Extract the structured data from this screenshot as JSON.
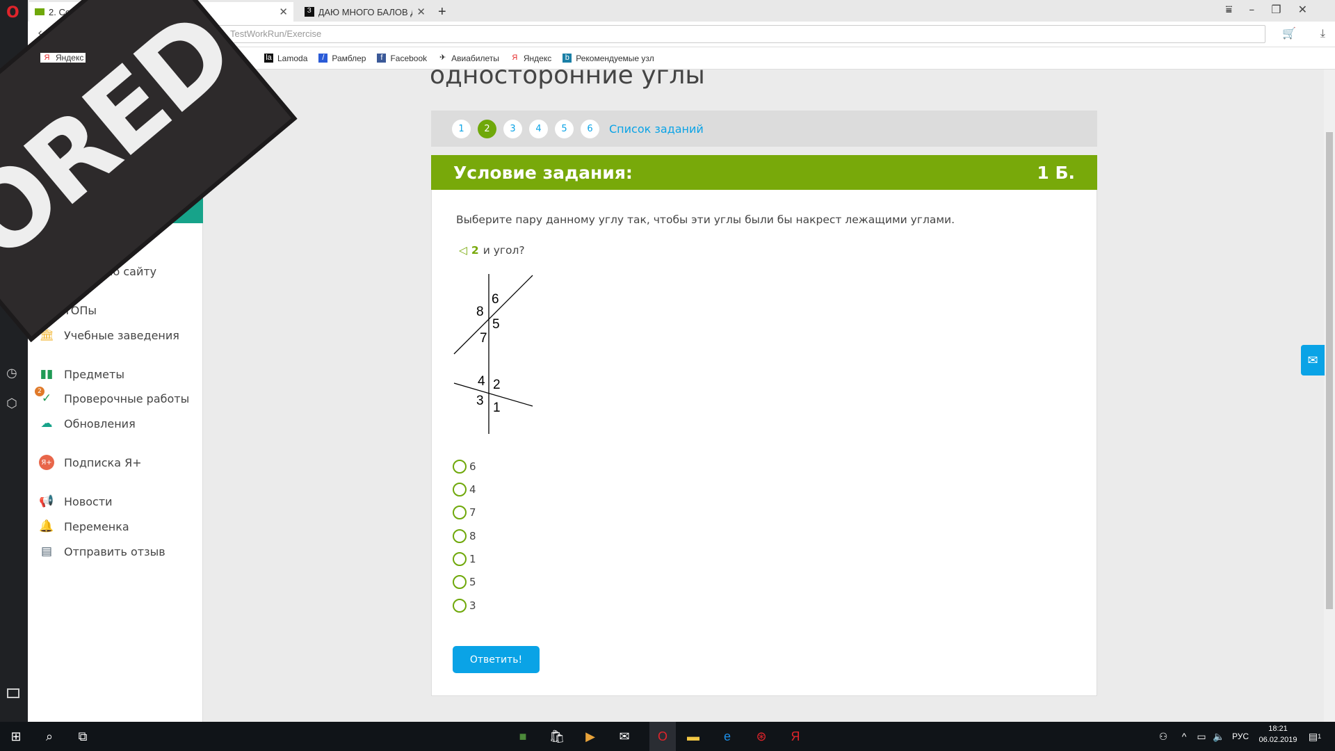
{
  "browser": {
    "tabs": [
      {
        "label": "2. Соответственные, ... аналоги",
        "active": true
      },
      {
        "label": "ДАЮ МНОГО БАЛОВ Да",
        "active": false
      }
    ],
    "new_tab": "+",
    "address": "TestWorkRun/Exercise",
    "bookmarks": [
      "Яндекс",
      "Lamoda",
      "Рамблер",
      "Facebook",
      "Авиабилеты",
      "Яндекс",
      "Рекомендуемые узл"
    ]
  },
  "stamp_text": "SORED",
  "sidebar": {
    "items": [
      {
        "label": "по сайту",
        "icon": "search-icon"
      },
      {
        "label": "ТОПы",
        "icon": "trophy-icon"
      },
      {
        "label": "Учебные заведения",
        "icon": "institution-icon"
      },
      {
        "label": "Предметы",
        "icon": "book-icon"
      },
      {
        "label": "Проверочные работы",
        "icon": "check-icon",
        "badge": "2"
      },
      {
        "label": "Обновления",
        "icon": "cloud-icon"
      },
      {
        "label": "Подписка Я+",
        "icon": "ya-plus-icon"
      },
      {
        "label": "Новости",
        "icon": "megaphone-icon"
      },
      {
        "label": "Переменка",
        "icon": "bell-icon"
      },
      {
        "label": "Отправить отзыв",
        "icon": "feedback-icon"
      }
    ]
  },
  "main": {
    "title": "односторонние углы",
    "pager": {
      "pages": [
        "1",
        "2",
        "3",
        "4",
        "5",
        "6"
      ],
      "current": "2",
      "list_label": "Список заданий"
    },
    "condition": {
      "title": "Условие задания:",
      "points": "1 Б."
    },
    "question": "Выберите пару данному углу так, чтобы эти углы были бы накрест лежащими углами.",
    "sub": {
      "angle_symbol": "◁",
      "number": "2",
      "text": "и угол?"
    },
    "diagram_labels": [
      "6",
      "8",
      "5",
      "7",
      "4",
      "2",
      "3",
      "1"
    ],
    "options": [
      "6",
      "4",
      "7",
      "8",
      "1",
      "5",
      "3"
    ],
    "submit_label": "Ответить!"
  },
  "taskbar": {
    "lang": "РУС",
    "time": "18:21",
    "date": "06.02.2019",
    "notifications": "1"
  },
  "colors": {
    "green": "#78a90a",
    "blue": "#0aa3e6",
    "teal": "#17a38a"
  }
}
